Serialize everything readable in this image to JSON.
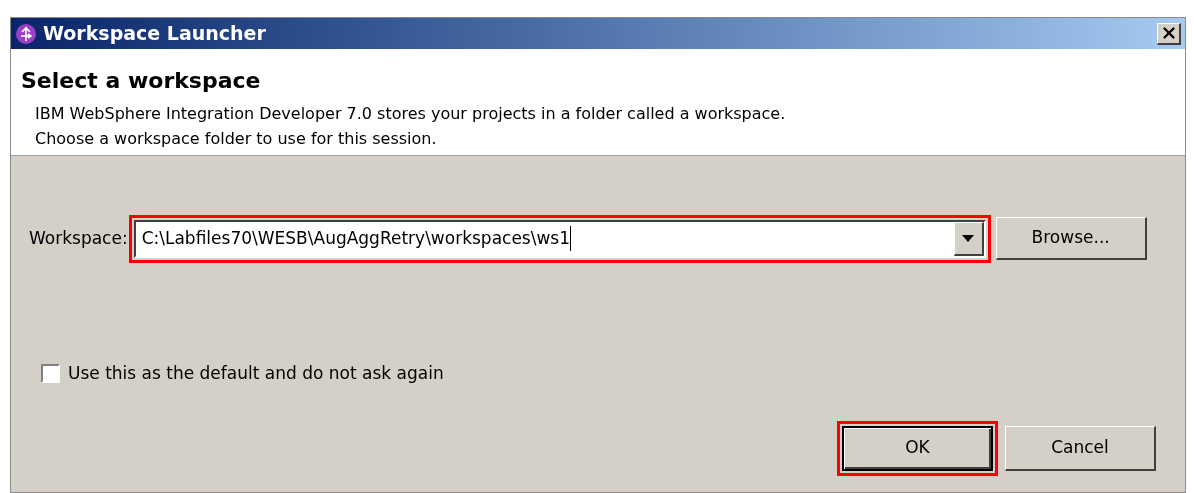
{
  "window": {
    "title": "Workspace Launcher"
  },
  "header": {
    "title": "Select a workspace",
    "lines": [
      "IBM WebSphere Integration Developer 7.0 stores your projects in a folder called a workspace.",
      "Choose a workspace folder to use for this session."
    ]
  },
  "workspace": {
    "label": "Workspace:",
    "value": "C:\\Labfiles70\\WESB\\AugAggRetry\\workspaces\\ws1",
    "highlighted": true
  },
  "browse_button": {
    "label": "Browse..."
  },
  "default_checkbox": {
    "label": "Use this as the default and do not ask again",
    "checked": false
  },
  "buttons": [
    {
      "label": "OK",
      "highlighted": true,
      "default": true
    },
    {
      "label": "Cancel",
      "default": false
    }
  ]
}
